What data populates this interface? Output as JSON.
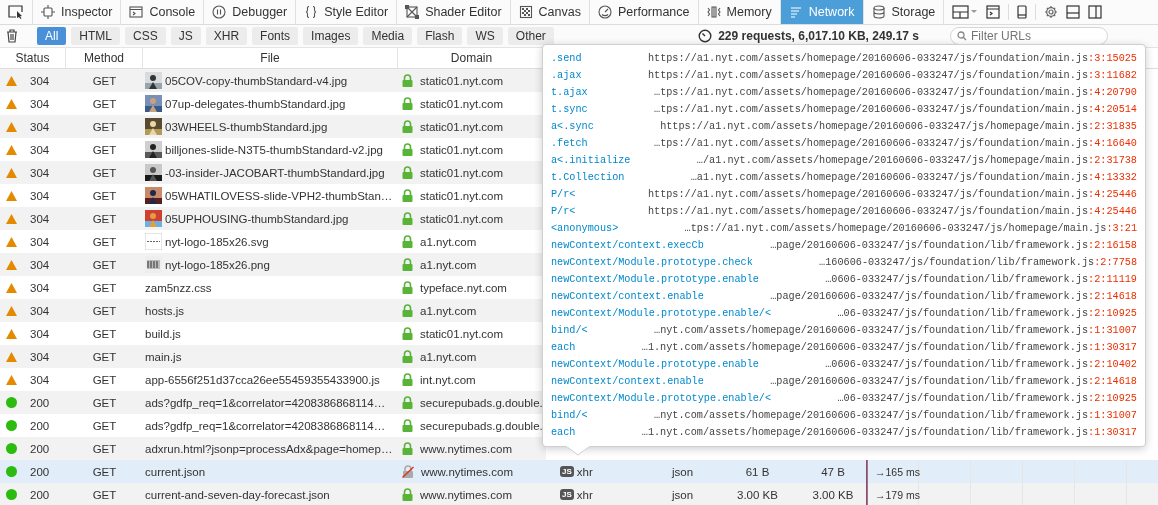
{
  "toolbar": {
    "tabs": [
      {
        "label": "Inspector",
        "selected": false
      },
      {
        "label": "Console",
        "selected": false
      },
      {
        "label": "Debugger",
        "selected": false
      },
      {
        "label": "Style Editor",
        "selected": false
      },
      {
        "label": "Shader Editor",
        "selected": false
      },
      {
        "label": "Canvas",
        "selected": false
      },
      {
        "label": "Performance",
        "selected": false
      },
      {
        "label": "Memory",
        "selected": false
      },
      {
        "label": "Network",
        "selected": true
      },
      {
        "label": "Storage",
        "selected": false
      }
    ]
  },
  "filter_bar": {
    "filters": [
      {
        "label": "All",
        "selected": true
      },
      {
        "label": "HTML",
        "selected": false
      },
      {
        "label": "CSS",
        "selected": false
      },
      {
        "label": "JS",
        "selected": false
      },
      {
        "label": "XHR",
        "selected": false
      },
      {
        "label": "Fonts",
        "selected": false
      },
      {
        "label": "Images",
        "selected": false
      },
      {
        "label": "Media",
        "selected": false
      },
      {
        "label": "Flash",
        "selected": false
      },
      {
        "label": "WS",
        "selected": false
      },
      {
        "label": "Other",
        "selected": false
      }
    ],
    "summary": "229 requests, 6,017.10 KB, 249.17 s",
    "search": {
      "placeholder": "Filter URLs"
    }
  },
  "table": {
    "columns": [
      "Status",
      "Method",
      "File",
      "Domain"
    ],
    "rows": [
      {
        "kind": "cached",
        "status": "304",
        "method": "GET",
        "thumbnail": true,
        "file": "05COV-copy-thumbStandard-v4.jpg",
        "secure": true,
        "domain": "static01.nyt.com",
        "selected": false
      },
      {
        "kind": "cached",
        "status": "304",
        "method": "GET",
        "thumbnail": true,
        "file": "07up-delegates-thumbStandard.jpg",
        "secure": true,
        "domain": "static01.nyt.com",
        "selected": false
      },
      {
        "kind": "cached",
        "status": "304",
        "method": "GET",
        "thumbnail": true,
        "file": "03WHEELS-thumbStandard.jpg",
        "secure": true,
        "domain": "static01.nyt.com",
        "selected": false
      },
      {
        "kind": "cached",
        "status": "304",
        "method": "GET",
        "thumbnail": true,
        "file": "billjones-slide-N3T5-thumbStandard-v2.jpg",
        "secure": true,
        "domain": "static01.nyt.com",
        "selected": false
      },
      {
        "kind": "cached",
        "status": "304",
        "method": "GET",
        "thumbnail": true,
        "file": "-03-insider-JACOBART-thumbStandard.jpg",
        "secure": true,
        "domain": "static01.nyt.com",
        "selected": false
      },
      {
        "kind": "cached",
        "status": "304",
        "method": "GET",
        "thumbnail": true,
        "file": "05WHATILOVESS-slide-VPH2-thumbStan…",
        "secure": true,
        "domain": "static01.nyt.com",
        "selected": false
      },
      {
        "kind": "cached",
        "status": "304",
        "method": "GET",
        "thumbnail": true,
        "file": "05UPHOUSING-thumbStandard.jpg",
        "secure": true,
        "domain": "static01.nyt.com",
        "selected": false
      },
      {
        "kind": "cached",
        "status": "304",
        "method": "GET",
        "thumbnail": true,
        "file": "nyt-logo-185x26.svg",
        "secure": true,
        "domain": "a1.nyt.com",
        "selected": false
      },
      {
        "kind": "cached",
        "status": "304",
        "method": "GET",
        "thumbnail": true,
        "file": "nyt-logo-185x26.png",
        "secure": true,
        "domain": "a1.nyt.com",
        "selected": false
      },
      {
        "kind": "cached",
        "status": "304",
        "method": "GET",
        "file": "zam5nzz.css",
        "secure": true,
        "domain": "typeface.nyt.com",
        "selected": false
      },
      {
        "kind": "cached",
        "status": "304",
        "method": "GET",
        "file": "hosts.js",
        "secure": true,
        "domain": "a1.nyt.com",
        "selected": false
      },
      {
        "kind": "cached",
        "status": "304",
        "method": "GET",
        "file": "build.js",
        "secure": true,
        "domain": "static01.nyt.com",
        "selected": false
      },
      {
        "kind": "cached",
        "status": "304",
        "method": "GET",
        "file": "main.js",
        "secure": true,
        "domain": "a1.nyt.com",
        "selected": false
      },
      {
        "kind": "cached",
        "status": "304",
        "method": "GET",
        "file": "app-6556f251d37cca26ee55459355433900.js",
        "secure": true,
        "domain": "int.nyt.com",
        "selected": false
      },
      {
        "kind": "ok",
        "status": "200",
        "method": "GET",
        "file": "ads?gdfp_req=1&correlator=4208386868114…",
        "secure": true,
        "domain": "securepubads.g.double.",
        "selected": false
      },
      {
        "kind": "ok",
        "status": "200",
        "method": "GET",
        "file": "ads?gdfp_req=1&correlator=4208386868114…",
        "secure": true,
        "domain": "securepubads.g.double.",
        "selected": false
      },
      {
        "kind": "ok",
        "status": "200",
        "method": "GET",
        "file": "adxrun.html?jsonp=processAdx&page=homep…",
        "secure": true,
        "domain": "www.nytimes.com",
        "selected": false
      },
      {
        "kind": "ok",
        "status": "200",
        "method": "GET",
        "file": "current.json",
        "secure": false,
        "domain": "www.nytimes.com",
        "cause_badge": "JS",
        "cause": "xhr",
        "type": "json",
        "transferred": "61 B",
        "size": "47 B",
        "timing": "→165 ms",
        "selected": true
      },
      {
        "kind": "ok",
        "status": "200",
        "method": "GET",
        "file": "current-and-seven-day-forecast.json",
        "secure": true,
        "domain": "www.nytimes.com",
        "cause_badge": "JS",
        "cause": "xhr",
        "type": "json",
        "transferred": "3.00 KB",
        "size": "3.00 KB",
        "timing": "→179 ms",
        "selected": false
      }
    ]
  },
  "stack_popup": {
    "frames": [
      {
        "function": ".send",
        "location": "https://a1.nyt.com/assets/homepage/20160606-033247/js/foundation/main.js",
        "line": ":3:15025"
      },
      {
        "function": ".ajax",
        "location": "https://a1.nyt.com/assets/homepage/20160606-033247/js/foundation/main.js",
        "line": ":3:11682"
      },
      {
        "function": "t.ajax",
        "location": "…tps://a1.nyt.com/assets/homepage/20160606-033247/js/foundation/main.js",
        "line": ":4:20790"
      },
      {
        "function": "t.sync",
        "location": "…tps://a1.nyt.com/assets/homepage/20160606-033247/js/foundation/main.js",
        "line": ":4:20514"
      },
      {
        "function": "a<.sync",
        "location": "https://a1.nyt.com/assets/homepage/20160606-033247/js/homepage/main.js",
        "line": ":2:31835"
      },
      {
        "function": ".fetch",
        "location": "…tps://a1.nyt.com/assets/homepage/20160606-033247/js/foundation/main.js",
        "line": ":4:16640"
      },
      {
        "function": "a<.initialize",
        "location": "…/a1.nyt.com/assets/homepage/20160606-033247/js/homepage/main.js",
        "line": ":2:31738"
      },
      {
        "function": "t.Collection",
        "location": "…a1.nyt.com/assets/homepage/20160606-033247/js/foundation/main.js",
        "line": ":4:13332"
      },
      {
        "function": "P/r<",
        "location": "https://a1.nyt.com/assets/homepage/20160606-033247/js/foundation/main.js",
        "line": ":4:25446"
      },
      {
        "function": "P/r<",
        "location": "https://a1.nyt.com/assets/homepage/20160606-033247/js/foundation/main.js",
        "line": ":4:25446"
      },
      {
        "function": "<anonymous>",
        "location": "…tps://a1.nyt.com/assets/homepage/20160606-033247/js/homepage/main.js",
        "line": ":3:21"
      },
      {
        "function": "newContext/context.execCb",
        "location": "…page/20160606-033247/js/foundation/lib/framework.js",
        "line": ":2:16158"
      },
      {
        "function": "newContext/Module.prototype.check",
        "location": "…160606-033247/js/foundation/lib/framework.js",
        "line": ":2:7758"
      },
      {
        "function": "newContext/Module.prototype.enable",
        "location": "…0606-033247/js/foundation/lib/framework.js",
        "line": ":2:11119"
      },
      {
        "function": "newContext/context.enable",
        "location": "…page/20160606-033247/js/foundation/lib/framework.js",
        "line": ":2:14618"
      },
      {
        "function": "newContext/Module.prototype.enable/<",
        "location": "…06-033247/js/foundation/lib/framework.js",
        "line": ":2:10925"
      },
      {
        "function": "bind/<",
        "location": "…nyt.com/assets/homepage/20160606-033247/js/foundation/lib/framework.js",
        "line": ":1:31007"
      },
      {
        "function": "each",
        "location": "…1.nyt.com/assets/homepage/20160606-033247/js/foundation/lib/framework.js",
        "line": ":1:30317"
      },
      {
        "function": "newContext/Module.prototype.enable",
        "location": "…0606-033247/js/foundation/lib/framework.js",
        "line": ":2:10402"
      },
      {
        "function": "newContext/context.enable",
        "location": "…page/20160606-033247/js/foundation/lib/framework.js",
        "line": ":2:14618"
      },
      {
        "function": "newContext/Module.prototype.enable/<",
        "location": "…06-033247/js/foundation/lib/framework.js",
        "line": ":2:10925"
      },
      {
        "function": "bind/<",
        "location": "…nyt.com/assets/homepage/20160606-033247/js/foundation/lib/framework.js",
        "line": ":1:31007"
      },
      {
        "function": "each",
        "location": "…1.nyt.com/assets/homepage/20160606-033247/js/foundation/lib/framework.js",
        "line": ":1:30317"
      }
    ]
  }
}
